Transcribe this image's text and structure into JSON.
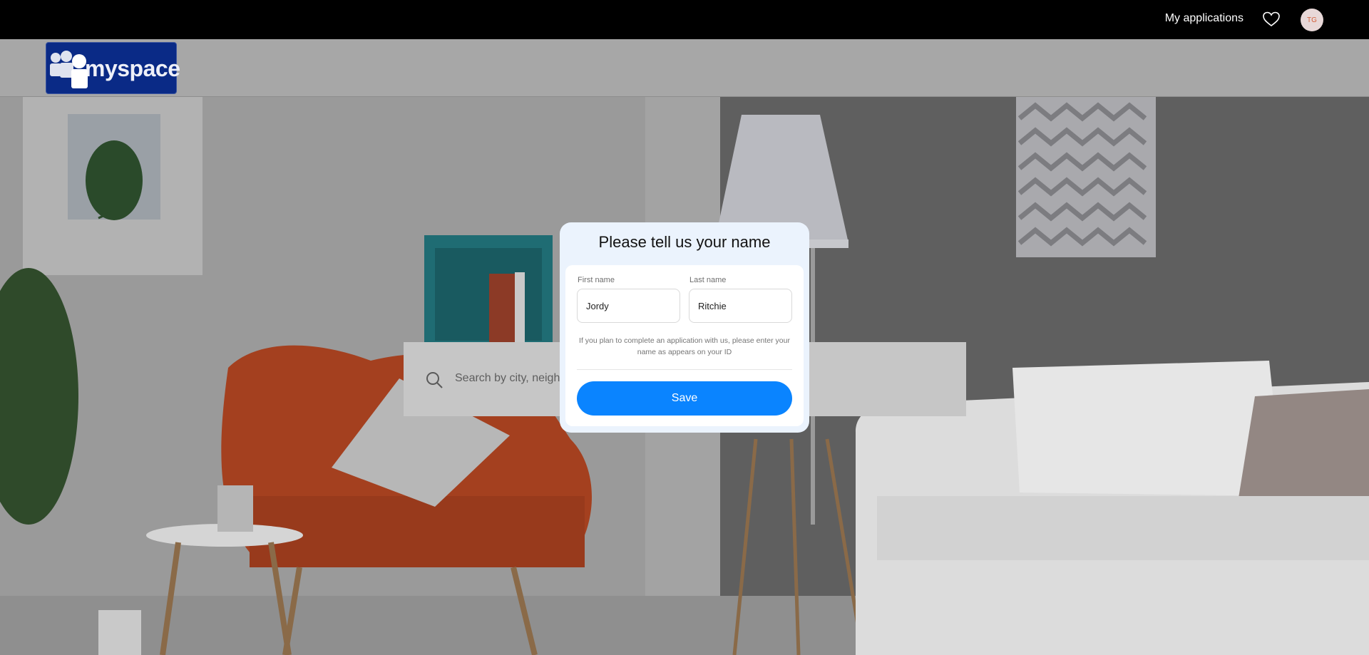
{
  "topbar": {
    "my_applications": "My applications",
    "avatar_initials": "TG"
  },
  "logo": {
    "text": "myspace"
  },
  "search": {
    "placeholder": "Search by city, neigh"
  },
  "modal": {
    "title": "Please tell us your name",
    "first_name_label": "First name",
    "first_name_value": "Jordy",
    "last_name_label": "Last name",
    "last_name_value": "Ritchie",
    "hint": "If you plan to complete an application with us, please enter your name as appears on your ID",
    "save_label": "Save"
  },
  "colors": {
    "save_button": "#0a84ff",
    "logo_bg": "#0a2a86",
    "topbar_bg": "#000000"
  }
}
